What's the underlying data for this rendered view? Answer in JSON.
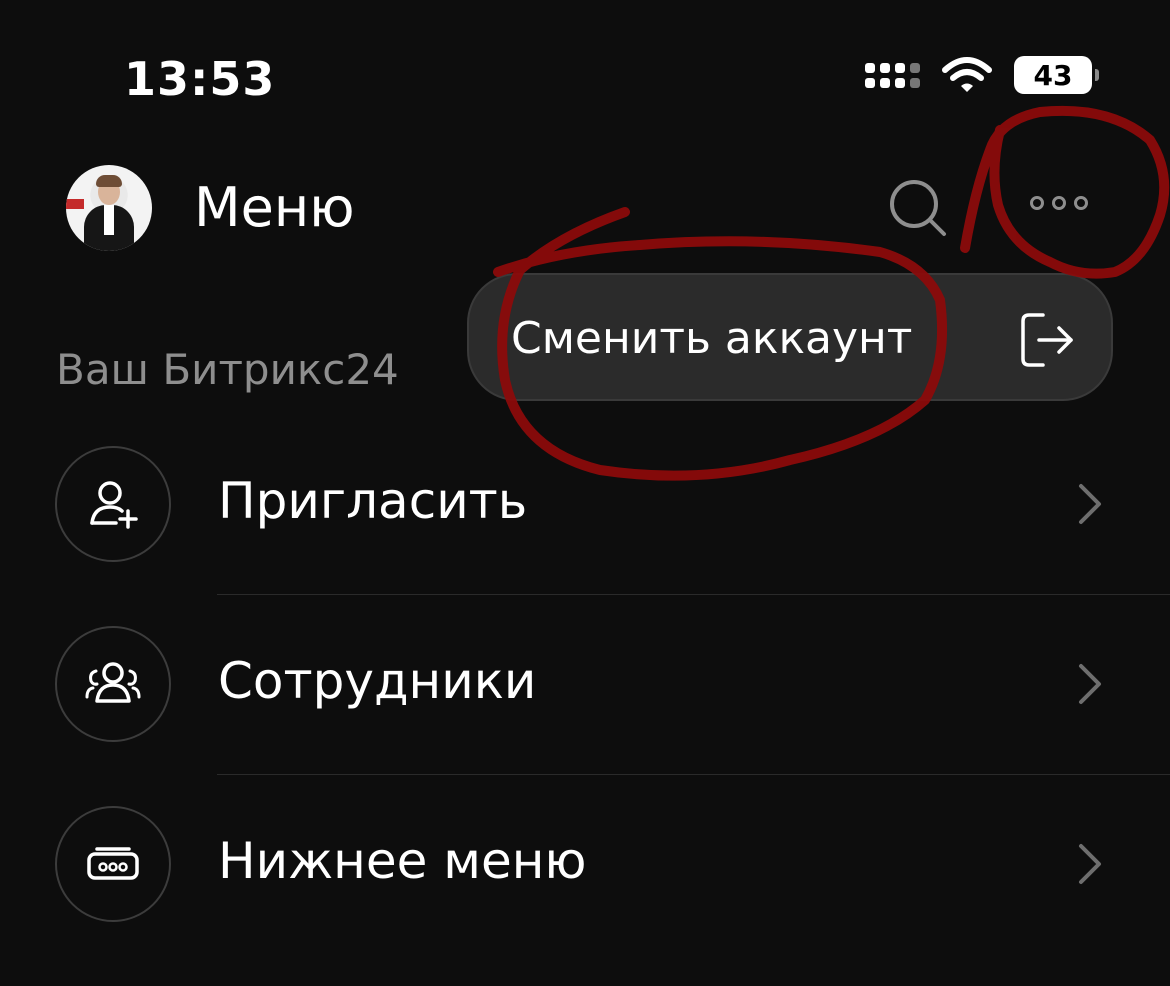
{
  "status_bar": {
    "time": "13:53",
    "battery": "43"
  },
  "header": {
    "title": "Меню",
    "avatar": "user-avatar",
    "search_icon": "search-icon",
    "more_icon": "more-dots-icon"
  },
  "popup_menu": {
    "item_label": "Сменить аккаунт",
    "item_icon": "logout-icon"
  },
  "section": {
    "label": "Ваш Битрикс24"
  },
  "menu": {
    "items": [
      {
        "label": "Пригласить",
        "icon": "add-user-icon"
      },
      {
        "label": "Сотрудники",
        "icon": "team-icon"
      },
      {
        "label": "Нижнее меню",
        "icon": "bottom-menu-icon"
      }
    ]
  },
  "colors": {
    "background": "#0d0d0d",
    "popup": "#2b2b2b",
    "muted_text": "#8e8e8e",
    "annotation": "#8b0b0b"
  }
}
